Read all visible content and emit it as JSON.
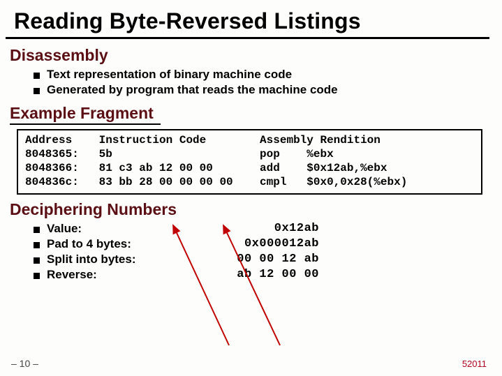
{
  "title": "Reading Byte-Reversed Listings",
  "sections": {
    "disassembly": {
      "heading": "Disassembly",
      "bullets": [
        "Text representation of binary machine code",
        "Generated by program that reads the machine code"
      ]
    },
    "example": {
      "heading": "Example Fragment",
      "code": "Address    Instruction Code        Assembly Rendition\n8048365:   5b                      pop    %ebx\n8048366:   81 c3 ab 12 00 00       add    $0x12ab,%ebx\n804836c:   83 bb 28 00 00 00 00    cmpl   $0x0,0x28(%ebx)"
    },
    "decipher": {
      "heading": "Deciphering Numbers",
      "rows": [
        {
          "label": "Value:",
          "value": "0x12ab"
        },
        {
          "label": "Pad to 4 bytes:",
          "value": "0x000012ab"
        },
        {
          "label": "Split into bytes:",
          "value": "00 00 12 ab"
        },
        {
          "label": "Reverse:",
          "value": "ab 12 00 00"
        }
      ]
    }
  },
  "footer": {
    "left": "– 10 –",
    "right": "52011"
  }
}
